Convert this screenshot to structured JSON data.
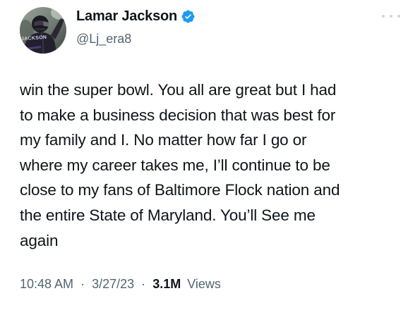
{
  "author": {
    "display_name": "Lamar Jackson",
    "handle": "@Lj_era8",
    "verified": true,
    "avatar_jersey_text": "JACKSON"
  },
  "tweet": {
    "text": "win the super bowl. You all are great but I had\nto make a business decision that was best for\nmy family and I. No matter how far I go or\nwhere my career takes me, I’ll continue to be\nclose to my fans of Baltimore Flock nation and\nthe entire State of Maryland. You’ll See me\nagain"
  },
  "meta": {
    "time": "10:48 AM",
    "separator": "·",
    "date": "3/27/23",
    "views_count": "3.1M",
    "views_label": "Views"
  },
  "icons": {
    "verified": "verified-badge-icon",
    "more": "more-options-icon"
  },
  "colors": {
    "verified_blue": "#1d9bf0",
    "text_primary": "#0f1419",
    "text_secondary": "#536471",
    "more_dots": "#cfd5da"
  }
}
